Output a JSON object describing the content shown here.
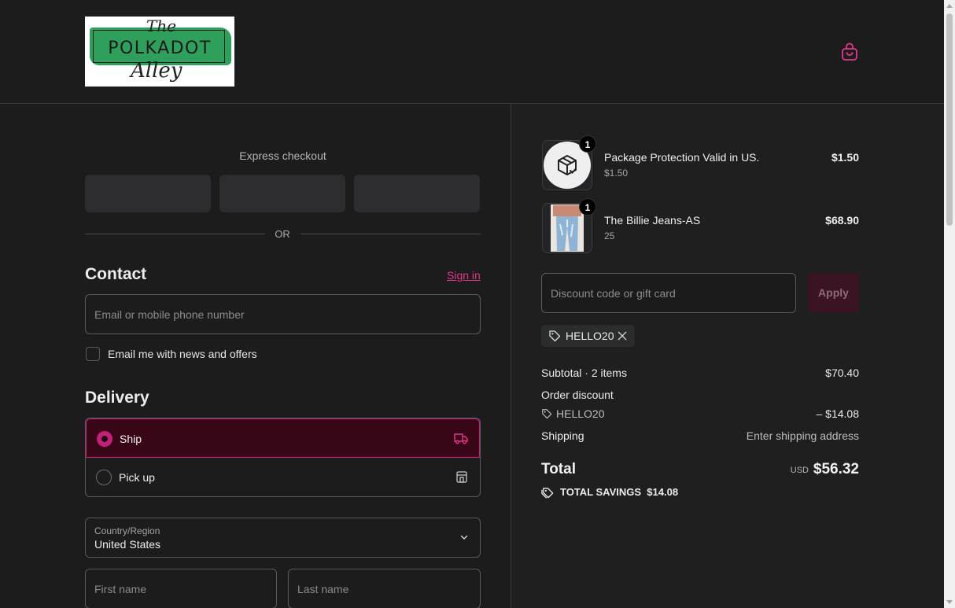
{
  "brand": {
    "logo_line1": "The",
    "logo_line2": "POLKADOT",
    "logo_line3": "Alley"
  },
  "express": {
    "title": "Express checkout",
    "or_label": "OR"
  },
  "contact": {
    "heading": "Contact",
    "sign_in": "Sign in",
    "email_placeholder": "Email or mobile phone number",
    "news_label": "Email me with news and offers"
  },
  "delivery": {
    "heading": "Delivery",
    "options": [
      {
        "label": "Ship",
        "selected": true,
        "icon": "truck-icon"
      },
      {
        "label": "Pick up",
        "selected": false,
        "icon": "store-icon"
      }
    ],
    "country_label": "Country/Region",
    "country_value": "United States",
    "first_name_placeholder": "First name",
    "last_name_placeholder": "Last name"
  },
  "cart": {
    "items": [
      {
        "name": "Package Protection Valid in US.",
        "sub": "$1.50",
        "price": "$1.50",
        "qty": "1",
        "icon": "package-check-icon"
      },
      {
        "name": "The Billie Jeans-AS",
        "sub": "25",
        "price": "$68.90",
        "qty": "1",
        "icon": "jeans-image"
      }
    ],
    "discount_placeholder": "Discount code or gift card",
    "apply_label": "Apply",
    "applied_code": "HELLO20"
  },
  "summary": {
    "subtotal_label": "Subtotal · 2 items",
    "subtotal_value": "$70.40",
    "order_discount_label": "Order discount",
    "discount_code": "HELLO20",
    "discount_value": "– $14.08",
    "shipping_label": "Shipping",
    "shipping_value": "Enter shipping address",
    "total_label": "Total",
    "currency": "USD",
    "total_value": "$56.32",
    "savings_label": "TOTAL SAVINGS",
    "savings_value": "$14.08"
  },
  "colors": {
    "accent": "#e3378f",
    "ship_bg": "#380617",
    "background": "#1c1c1d"
  }
}
